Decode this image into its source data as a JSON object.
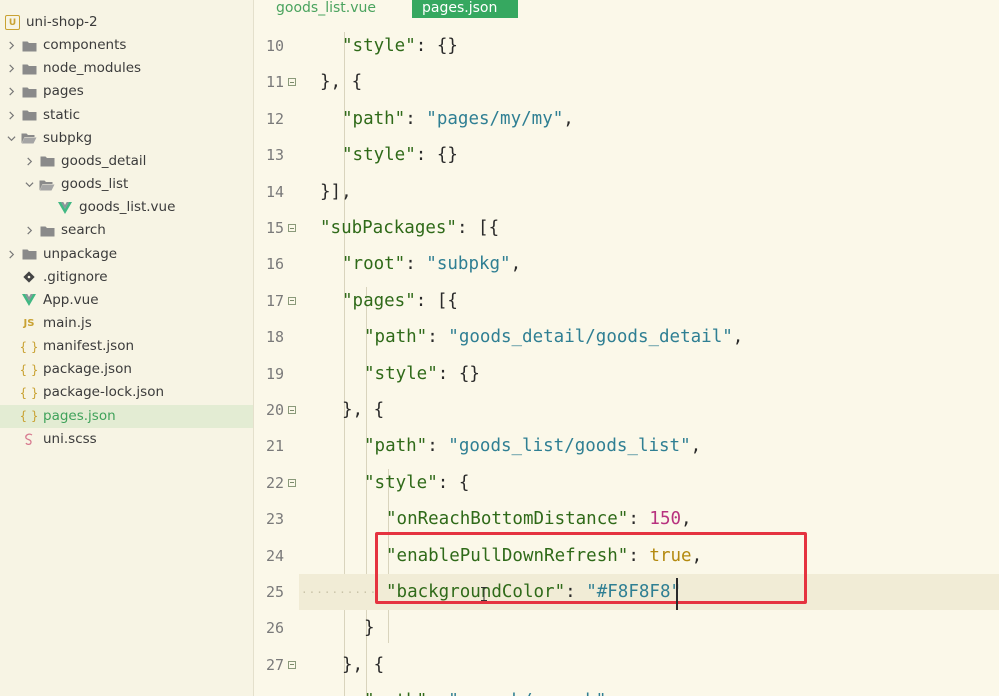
{
  "sidebar": {
    "items": [
      {
        "label": "uni-shop-2",
        "icon": "project-icon",
        "chevron": "none"
      },
      {
        "label": "components",
        "icon": "folder-icon",
        "chevron": "right"
      },
      {
        "label": "node_modules",
        "icon": "folder-icon",
        "chevron": "right"
      },
      {
        "label": "pages",
        "icon": "folder-icon",
        "chevron": "right"
      },
      {
        "label": "static",
        "icon": "folder-icon",
        "chevron": "right"
      },
      {
        "label": "subpkg",
        "icon": "folder-open-icon",
        "chevron": "down"
      },
      {
        "label": "goods_detail",
        "icon": "folder-icon",
        "chevron": "right"
      },
      {
        "label": "goods_list",
        "icon": "folder-open-icon",
        "chevron": "down"
      },
      {
        "label": "goods_list.vue",
        "icon": "vue-icon",
        "chevron": "none"
      },
      {
        "label": "search",
        "icon": "folder-icon",
        "chevron": "right"
      },
      {
        "label": "unpackage",
        "icon": "folder-icon",
        "chevron": "right"
      },
      {
        "label": ".gitignore",
        "icon": "git-icon",
        "chevron": "none"
      },
      {
        "label": "App.vue",
        "icon": "vue-icon",
        "chevron": "none"
      },
      {
        "label": "main.js",
        "icon": "js-icon",
        "chevron": "none"
      },
      {
        "label": "manifest.json",
        "icon": "json-icon",
        "chevron": "none"
      },
      {
        "label": "package.json",
        "icon": "json-icon",
        "chevron": "none"
      },
      {
        "label": "package-lock.json",
        "icon": "json-icon",
        "chevron": "none"
      },
      {
        "label": "pages.json",
        "icon": "json-icon",
        "chevron": "none",
        "selected": true
      },
      {
        "label": "uni.scss",
        "icon": "scss-icon",
        "chevron": "none"
      }
    ],
    "root_badge": "U",
    "js_badge": "JS",
    "json_badge": "{ }"
  },
  "tabs": [
    {
      "label": "goods_list.vue",
      "active": false
    },
    {
      "label": "pages.json",
      "active": true
    }
  ],
  "editor": {
    "lines": [
      {
        "n": "10",
        "tokens": [
          [
            "k",
            "\"style\""
          ],
          [
            "p",
            ": {}"
          ]
        ]
      },
      {
        "n": "11",
        "tokens": [
          [
            "p",
            "}, {"
          ]
        ],
        "fold": true
      },
      {
        "n": "12",
        "tokens": [
          [
            "k",
            "\"path\""
          ],
          [
            "p",
            ": "
          ],
          [
            "s",
            "\"pages/my/my\""
          ],
          [
            "p",
            ","
          ]
        ]
      },
      {
        "n": "13",
        "tokens": [
          [
            "k",
            "\"style\""
          ],
          [
            "p",
            ": {}"
          ]
        ]
      },
      {
        "n": "14",
        "tokens": [
          [
            "p",
            "}],"
          ]
        ]
      },
      {
        "n": "15",
        "tokens": [
          [
            "k",
            "\"subPackages\""
          ],
          [
            "p",
            ": [{"
          ]
        ],
        "fold": true
      },
      {
        "n": "16",
        "tokens": [
          [
            "k",
            "\"root\""
          ],
          [
            "p",
            ": "
          ],
          [
            "s",
            "\"subpkg\""
          ],
          [
            "p",
            ","
          ]
        ]
      },
      {
        "n": "17",
        "tokens": [
          [
            "k",
            "\"pages\""
          ],
          [
            "p",
            ": [{"
          ]
        ],
        "fold": true
      },
      {
        "n": "18",
        "tokens": [
          [
            "k",
            "\"path\""
          ],
          [
            "p",
            ": "
          ],
          [
            "s",
            "\"goods_detail/goods_detail\""
          ],
          [
            "p",
            ","
          ]
        ]
      },
      {
        "n": "19",
        "tokens": [
          [
            "k",
            "\"style\""
          ],
          [
            "p",
            ": {}"
          ]
        ]
      },
      {
        "n": "20",
        "tokens": [
          [
            "p",
            "}, {"
          ]
        ],
        "fold": true
      },
      {
        "n": "21",
        "tokens": [
          [
            "k",
            "\"path\""
          ],
          [
            "p",
            ": "
          ],
          [
            "s",
            "\"goods_list/goods_list\""
          ],
          [
            "p",
            ","
          ]
        ]
      },
      {
        "n": "22",
        "tokens": [
          [
            "k",
            "\"style\""
          ],
          [
            "p",
            ": {"
          ]
        ],
        "fold": true
      },
      {
        "n": "23",
        "tokens": [
          [
            "k",
            "\"onReachBottomDistance\""
          ],
          [
            "p",
            ": "
          ],
          [
            "n",
            "150"
          ],
          [
            "p",
            ","
          ]
        ]
      },
      {
        "n": "24",
        "tokens": [
          [
            "k",
            "\"enablePullDownRefresh\""
          ],
          [
            "p",
            ": "
          ],
          [
            "b",
            "true"
          ],
          [
            "p",
            ","
          ]
        ]
      },
      {
        "n": "25",
        "tokens": [
          [
            "k",
            "\"backgroundColor\""
          ],
          [
            "p",
            ": "
          ],
          [
            "s",
            "\"#F8F8F8\""
          ]
        ],
        "current": true
      },
      {
        "n": "26",
        "tokens": [
          [
            "p",
            "}"
          ]
        ]
      },
      {
        "n": "27",
        "tokens": [
          [
            "p",
            "}, {"
          ]
        ],
        "fold": true
      },
      {
        "n": "",
        "tokens": [
          [
            "k",
            "\"path\""
          ],
          [
            "p",
            ": "
          ],
          [
            "s",
            "\"search/search\""
          ]
        ]
      }
    ]
  },
  "colors": {
    "accent": "#36a860",
    "highlight_box": "#e53340",
    "key": "#2f6a19",
    "string": "#2f7f93",
    "number": "#b8327f",
    "boolean": "#b48a10"
  }
}
